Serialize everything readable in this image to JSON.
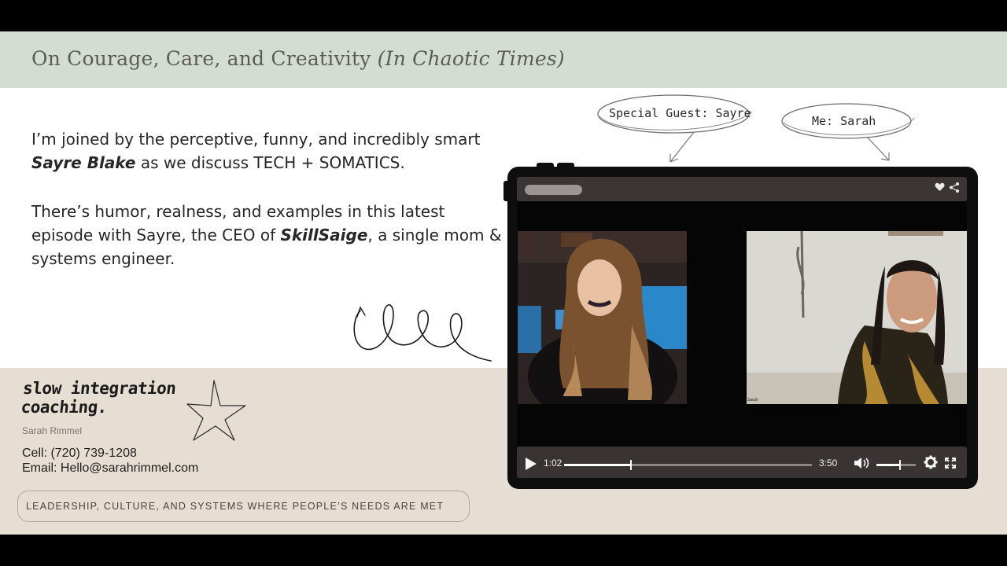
{
  "header": {
    "title_regular": "On Courage, Care, and Creativity",
    "title_italic": "(In Chaotic Times)"
  },
  "intro": {
    "p1_before": "I’m joined by the perceptive, funny, and incredibly smart ",
    "p1_name": "Sayre Blake",
    "p1_after": " as we discuss TECH + SOMATICS.",
    "p2_before": "There’s humor, realness, and examples in this latest episode with Sayre, the CEO of ",
    "p2_company": "SkillSaige",
    "p2_after": ", a single mom & systems engineer."
  },
  "callouts": {
    "guest": "Special Guest: Sayre",
    "me": "Me: Sarah"
  },
  "brand": {
    "logo_text_line1": "slow integration",
    "logo_text_line2": "coaching.",
    "name": "Sarah Rimmel"
  },
  "contact": {
    "cell": "Cell: (720) 739-1208",
    "email": "Email: Hello@sarahrimmel.com"
  },
  "tagline": "LEADERSHIP, CULTURE, AND SYSTEMS WHERE PEOPLE’S NEEDS ARE MET",
  "player": {
    "current_time": "1:02",
    "duration": "3:50",
    "progress_fraction": 0.27,
    "volume_fraction": 0.6,
    "right_video_label": "Sarah",
    "icons": [
      "heart-icon",
      "share-icon",
      "play-icon",
      "volume-icon",
      "settings-gear-icon",
      "fullscreen-icon"
    ]
  },
  "colors": {
    "header_band": "#d4ddd2",
    "bottom_band": "#e6ddd3",
    "player_chrome": "#3a3333"
  }
}
